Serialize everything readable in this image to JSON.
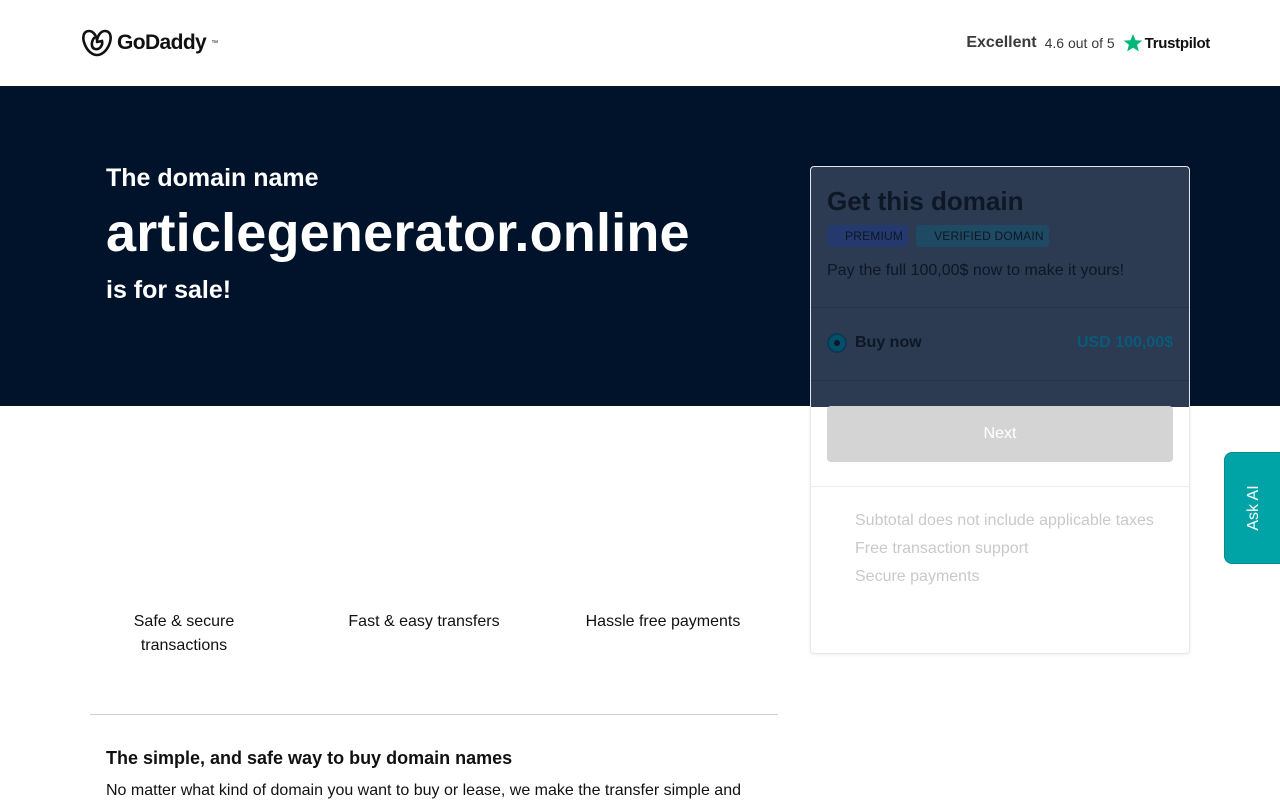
{
  "header": {
    "brand": "GoDaddy",
    "rating_word": "Excellent",
    "rating_score": "4.6 out of 5",
    "trustpilot": "Trustpilot",
    "trustpilot_color": "#00b67a"
  },
  "hero": {
    "pre": "The domain name",
    "domain": "articlegenerator.online",
    "post": "is for sale!",
    "background": "#00132b"
  },
  "features": [
    "Safe & secure transactions",
    "Fast & easy transfers",
    "Hassle free payments"
  ],
  "section": {
    "title": "The simple, and safe way to buy domain names",
    "body": "No matter what kind of domain you want to buy or lease, we make the transfer simple and"
  },
  "card": {
    "title": "Get this domain",
    "badges": [
      "PREMIUM",
      "VERIFIED DOMAIN"
    ],
    "description": "Pay the full 100,00$ now to make it yours!",
    "option_label": "Buy now",
    "option_price": "USD 100,00$",
    "next_label": "Next",
    "benefits": [
      "Subtotal does not include applicable taxes",
      "Free transaction support",
      "Secure payments"
    ]
  },
  "ask_ai": {
    "label": "Ask AI",
    "color": "#00a4a6"
  }
}
